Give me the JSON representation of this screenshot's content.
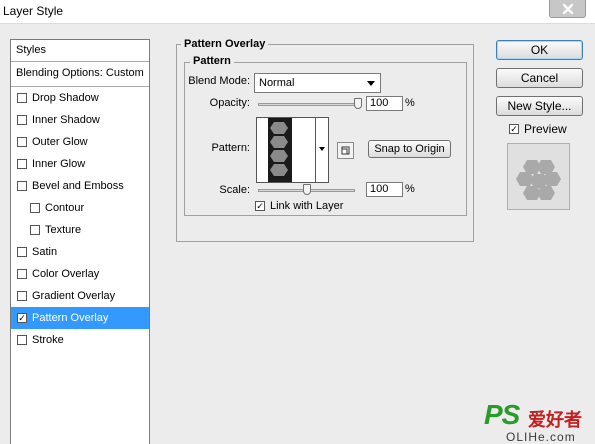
{
  "window": {
    "title": "Layer Style",
    "close_icon": "close-icon"
  },
  "styles_list": {
    "header": "Styles",
    "blending": "Blending Options: Custom",
    "items": [
      {
        "label": "Drop Shadow",
        "checked": false,
        "sub": false,
        "selected": false
      },
      {
        "label": "Inner Shadow",
        "checked": false,
        "sub": false,
        "selected": false
      },
      {
        "label": "Outer Glow",
        "checked": false,
        "sub": false,
        "selected": false
      },
      {
        "label": "Inner Glow",
        "checked": false,
        "sub": false,
        "selected": false
      },
      {
        "label": "Bevel and Emboss",
        "checked": false,
        "sub": false,
        "selected": false
      },
      {
        "label": "Contour",
        "checked": false,
        "sub": true,
        "selected": false
      },
      {
        "label": "Texture",
        "checked": false,
        "sub": true,
        "selected": false
      },
      {
        "label": "Satin",
        "checked": false,
        "sub": false,
        "selected": false
      },
      {
        "label": "Color Overlay",
        "checked": false,
        "sub": false,
        "selected": false
      },
      {
        "label": "Gradient Overlay",
        "checked": false,
        "sub": false,
        "selected": false
      },
      {
        "label": "Pattern Overlay",
        "checked": true,
        "sub": false,
        "selected": true
      },
      {
        "label": "Stroke",
        "checked": false,
        "sub": false,
        "selected": false
      }
    ]
  },
  "panel": {
    "section_title": "Pattern Overlay",
    "group_title": "Pattern",
    "blend_mode_label": "Blend Mode:",
    "blend_mode_value": "Normal",
    "opacity_label": "Opacity:",
    "opacity_value": "100",
    "opacity_fraction": 1.0,
    "opacity_unit": "%",
    "pattern_label": "Pattern:",
    "snap_button": "Snap to Origin",
    "scale_label": "Scale:",
    "scale_value": "100",
    "scale_fraction": 0.5,
    "scale_unit": "%",
    "link_label": "Link with Layer",
    "link_checked": true
  },
  "buttons": {
    "ok": "OK",
    "cancel": "Cancel",
    "new_style": "New Style..."
  },
  "preview": {
    "label": "Preview",
    "checked": true
  },
  "watermark": {
    "ps": "PS",
    "cn": "爱好者",
    "url": "OLIHe.com"
  },
  "colors": {
    "selection": "#3399ff",
    "dialog_bg": "#ececec",
    "watermark_green": "#2a9a2a",
    "watermark_red": "#c41f1f"
  }
}
